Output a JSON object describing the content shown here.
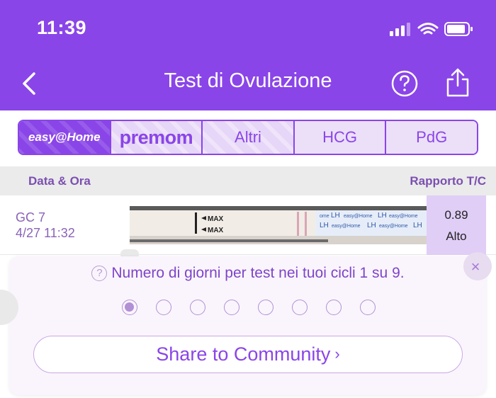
{
  "status_bar": {
    "time": "11:39"
  },
  "nav": {
    "title": "Test di Ovulazione"
  },
  "tabs": {
    "easy_logo": "easy@Home",
    "premom_logo": "premom",
    "items": [
      "Altri",
      "HCG",
      "PdG"
    ]
  },
  "list_header": {
    "left": "Data & Ora",
    "right": "Rapporto T/C"
  },
  "row": {
    "cycle_day": "GC 7",
    "datetime": "4/27 11:32",
    "ratio": "0.89",
    "level": "Alto",
    "strip_labels": [
      "MAX",
      "MAX"
    ]
  },
  "tip": {
    "text": "Numero di giorni per test nei tuoi cicli 1 su 9.",
    "icon": "?",
    "dots_total": 8,
    "dots_active": 1,
    "close_icon": "×"
  },
  "community_button": {
    "label": "Share to Community"
  },
  "colors": {
    "primary": "#8a45e8",
    "ratio_bg": "#e0cef7"
  }
}
